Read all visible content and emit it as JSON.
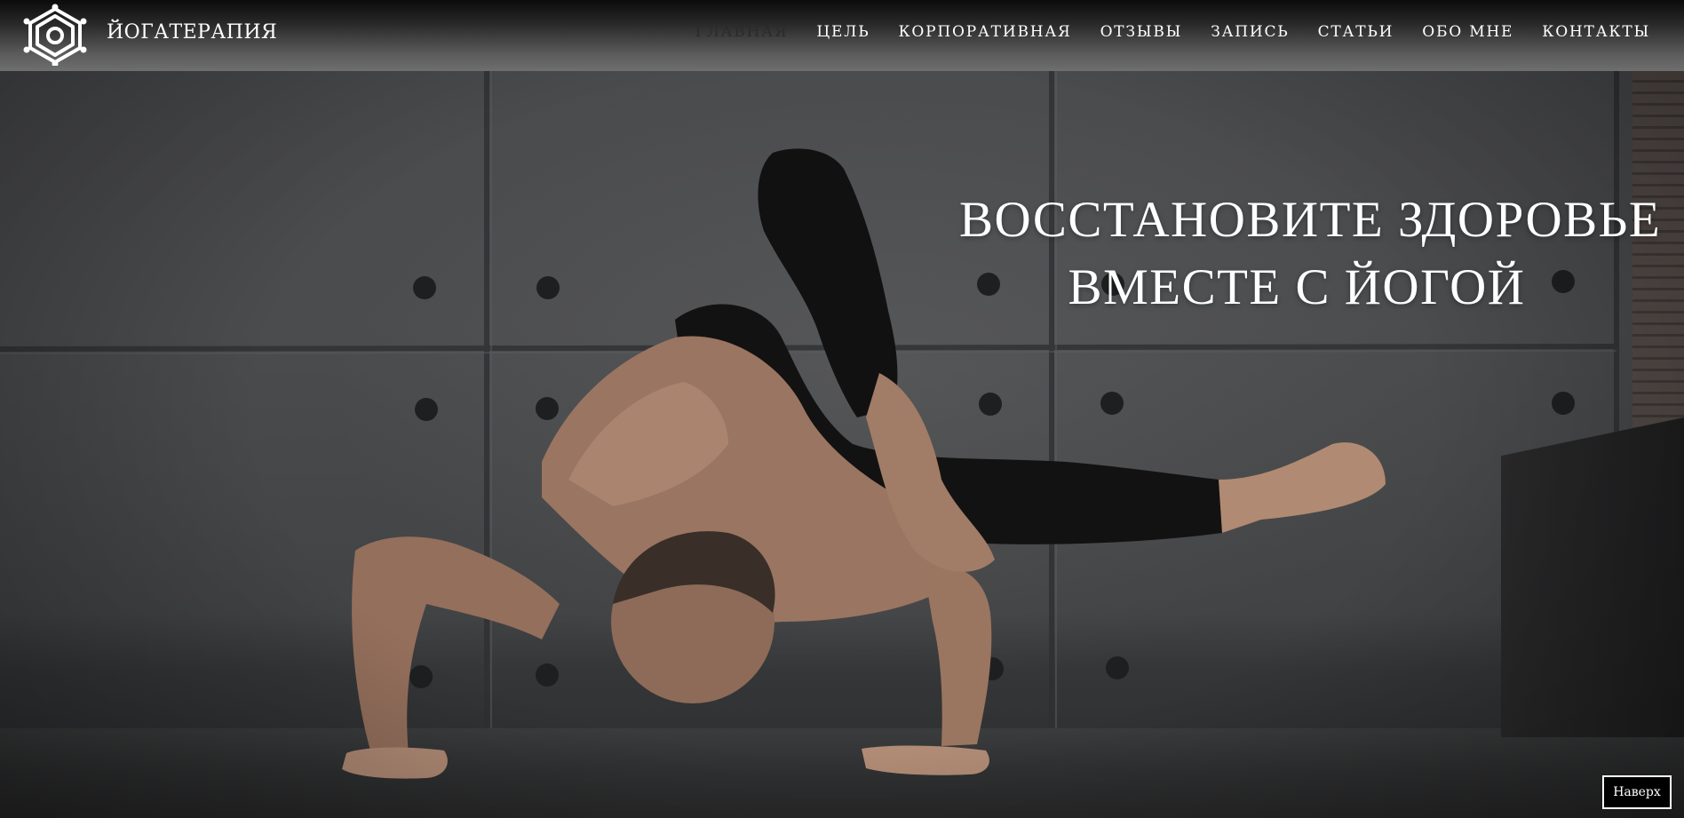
{
  "header": {
    "brand": "ЙОГАТЕРАПИЯ",
    "logo_icon": "lotus-wheel-icon"
  },
  "nav": {
    "items": [
      {
        "label": "ГЛАВНАЯ",
        "active": true
      },
      {
        "label": "ЦЕЛЬ",
        "active": false
      },
      {
        "label": "КОРПОРАТИВНАЯ",
        "active": false
      },
      {
        "label": "ОТЗЫВЫ",
        "active": false
      },
      {
        "label": "ЗАПИСЬ",
        "active": false
      },
      {
        "label": "СТАТЬИ",
        "active": false
      },
      {
        "label": "ОБО МНЕ",
        "active": false
      },
      {
        "label": "КОНТАКТЫ",
        "active": false
      }
    ]
  },
  "hero": {
    "headline_line1": "ВОССТАНОВИТЕ ЗДОРОВЬЕ",
    "headline_line2": "ВМЕСТЕ С ЙОГОЙ"
  },
  "back_to_top": {
    "label": "Наверх"
  },
  "colors": {
    "header_dark": "#0b0b0b",
    "header_light": "#6e6e6e",
    "nav_active": "#2b2b2b",
    "text": "#ffffff",
    "wall": "#4a4b4d"
  }
}
